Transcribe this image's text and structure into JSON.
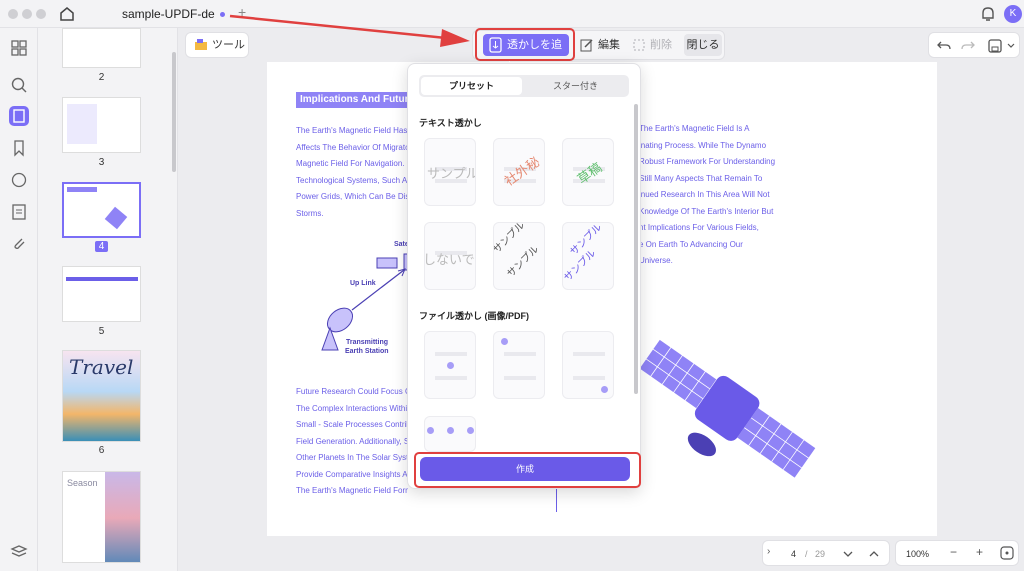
{
  "titlebar": {
    "doc_name": "sample-UPDF-de",
    "new_tab": "+",
    "avatar": "K"
  },
  "thumbnails": [
    {
      "page": "2"
    },
    {
      "page": "3"
    },
    {
      "page": "4",
      "selected": true
    },
    {
      "page": "5"
    },
    {
      "page": "6"
    }
  ],
  "thumb_text": {
    "travel_title": "Travel",
    "season_title": "Season"
  },
  "toolbar": {
    "tools_label": "ツール",
    "add_watermark": "透かしを追加",
    "edit": "編集",
    "delete": "削除",
    "close": "閉じる"
  },
  "page": {
    "title": "Implications And Future",
    "left_lines": [
      "The Earth's Magnetic Field Has F",
      "Affects The Behavior Of Migrator",
      "Magnetic Field For Navigation. It",
      "Technological Systems, Such As",
      "Power Grids, Which Can Be Disr",
      "Storms."
    ],
    "right_lines": [
      "The Earth's Magnetic Field Is A",
      "inating Process. While The Dynamo",
      "Robust Framework For Understanding",
      "Still Many Aspects That Remain To",
      "inued Research In This Area Will Not",
      "Knowledge Of The Earth's Interior But",
      "nt Implications For Various Fields,",
      "e On Earth To Advancing Our",
      "Universe."
    ],
    "bottom_lines": [
      "Future Research Could Focus On",
      "The Complex Interactions Within",
      "Small - Scale Processes Contribu",
      "Field Generation. Additionally, St",
      "Other Planets In The Solar Syste",
      "Provide Comparative Insights An",
      "The Earth's Magnetic Field Forma"
    ],
    "diagram_labels": {
      "sat": "Sate",
      "uplink": "Up Link",
      "station_1": "Transmitting",
      "station_2": "Earth Station"
    }
  },
  "popup": {
    "tab_preset": "プリセット",
    "tab_starred": "スター付き",
    "text_section": "テキスト透かし",
    "file_section": "ファイル透かし (画像/PDF)",
    "text_tiles": [
      {
        "text": "サンプル",
        "color": "#bbbbbb"
      },
      {
        "text": "社外秘",
        "color": "#e58a73"
      },
      {
        "text": "草稿",
        "color": "#5fbf6e"
      },
      {
        "text": "しないでく",
        "color": "#bbbbbb"
      },
      {
        "text": "サンプル",
        "color": "#555555"
      },
      {
        "text": "サンプル",
        "color": "#6a5ae8"
      }
    ],
    "create": "作成"
  },
  "nav": {
    "page_current": "4",
    "page_sep": "/",
    "page_total": "29",
    "zoom": "100%"
  },
  "colors": {
    "accent": "#7b6ef6",
    "highlight": "#e0403f"
  }
}
